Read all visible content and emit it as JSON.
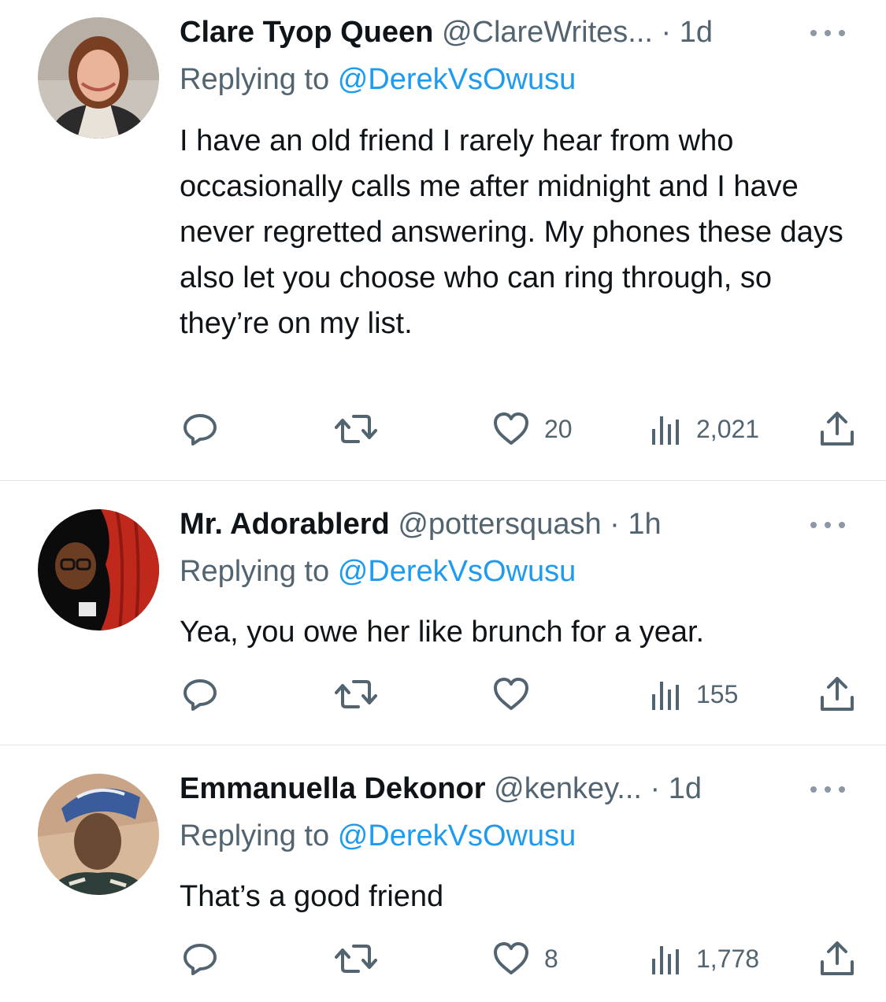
{
  "replies": [
    {
      "name": "Clare Tyop Queen",
      "handle": "@ClareWrites...",
      "time": "· 1d",
      "replying_prefix": "Replying to",
      "replying_to": "@DerekVsOwusu",
      "text": "I have an old friend I rarely hear from who occasionally calls me after midnight and I have never regretted answering. My phones these days also let you choose who can ring through, so they’re on my list.",
      "likes": "20",
      "views": "2,021"
    },
    {
      "name": "Mr. Adorablerd",
      "handle": "@pottersquash",
      "time": "· 1h",
      "replying_prefix": "Replying to",
      "replying_to": "@DerekVsOwusu",
      "text": "Yea, you owe her like brunch for a year.",
      "likes": "",
      "views": "155"
    },
    {
      "name": "Emmanuella Dekonor",
      "handle": "@kenkey...",
      "time": "· 1d",
      "replying_prefix": "Replying to",
      "replying_to": "@DerekVsOwusu",
      "text": "That’s a good friend",
      "likes": "8",
      "views": "1,778"
    }
  ],
  "icons": [
    "reply-icon",
    "retweet-icon",
    "like-icon",
    "views-icon",
    "share-icon",
    "more-icon"
  ],
  "colors": {
    "text": "#0f1419",
    "secondary": "#536471",
    "link": "#1d9bf0",
    "divider": "#e1e6ea"
  }
}
